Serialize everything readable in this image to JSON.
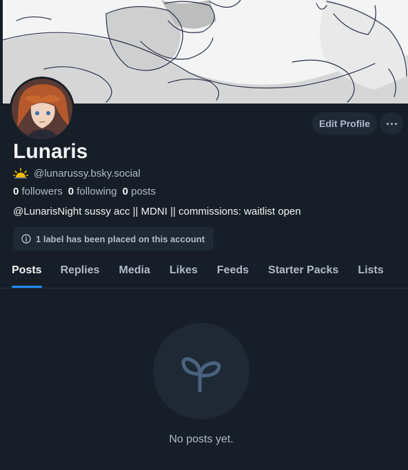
{
  "profile": {
    "display_name": "Lunaris",
    "handle": "@lunarussy.bsky.social",
    "stats": {
      "followers_count": "0",
      "followers_label": "followers",
      "following_count": "0",
      "following_label": "following",
      "posts_count": "0",
      "posts_label": "posts"
    },
    "bio": "@LunarisNight sussy acc || MDNI || commissions: waitlist open",
    "label_notice": "1 label has been placed on this account"
  },
  "actions": {
    "edit_profile": "Edit Profile",
    "more_label": "···"
  },
  "tabs": [
    {
      "label": "Posts"
    },
    {
      "label": "Replies"
    },
    {
      "label": "Media"
    },
    {
      "label": "Likes"
    },
    {
      "label": "Feeds"
    },
    {
      "label": "Starter Packs"
    },
    {
      "label": "Lists"
    }
  ],
  "empty_state": {
    "text": "No posts yet.",
    "icon": "sprout-icon"
  },
  "colors": {
    "background": "#161e27",
    "surface": "#1e2936",
    "accent": "#208bfe",
    "muted_text": "#aebbc9",
    "primary_text": "#f1f3f5",
    "badge": "#f5b800"
  }
}
